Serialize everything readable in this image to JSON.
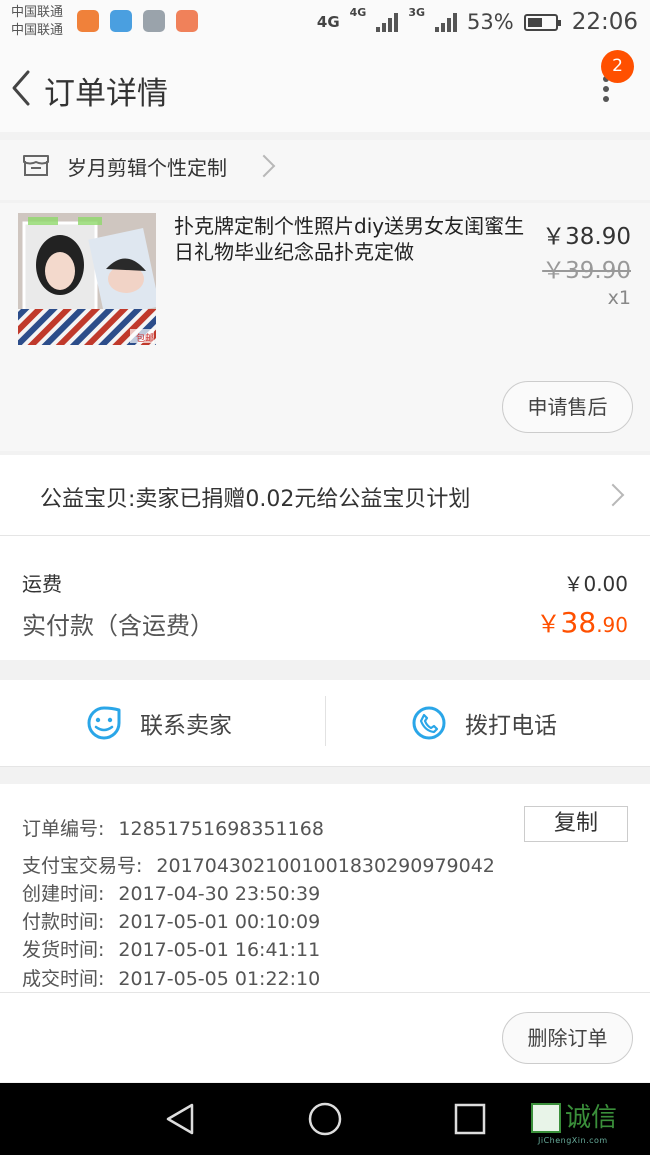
{
  "status_bar": {
    "carrier_1": "中国联通",
    "carrier_2": "中国联通",
    "network_1": "4G",
    "network_2": "4G",
    "network_3": "3G",
    "battery_percent": "53%",
    "battery_level": 0.53,
    "time": "22:06",
    "app_icons": [
      "uc-browser-icon",
      "health-icon",
      "gallery-icon",
      "camera-icon"
    ]
  },
  "header": {
    "title": "订单详情",
    "badge_count": "2"
  },
  "shop": {
    "name": "岁月剪辑个性定制"
  },
  "product": {
    "title": "扑克牌定制个性照片diy送男女友闺蜜生日礼物毕业纪念品扑克定做",
    "image_badge": "包邮",
    "price": "￥38.90",
    "original_price": "￥39.90",
    "quantity": "x1",
    "after_sale_label": "申请售后"
  },
  "charity": {
    "text": "公益宝贝:卖家已捐赠0.02元给公益宝贝计划"
  },
  "totals": {
    "shipping_label": "运费",
    "shipping_value": "￥0.00",
    "paid_label": "实付款（含运费）",
    "paid_symbol": "￥",
    "paid_integer": "38",
    "paid_decimal": ".90"
  },
  "contact": {
    "seller_label": "联系卖家",
    "phone_label": "拨打电话"
  },
  "order_info": {
    "copy_label": "复制",
    "rows": [
      {
        "label": "订单编号:",
        "value": "1285175169835116​8"
      },
      {
        "label": "支付宝交易号:",
        "value": "2017043021001001830290979042"
      },
      {
        "label": "创建时间:",
        "value": "2017-04-30 23:50:39"
      },
      {
        "label": "付款时间:",
        "value": "2017-05-01 00:10:09"
      },
      {
        "label": "发货时间:",
        "value": "2017-05-01 16:41:11"
      },
      {
        "label": "成交时间:",
        "value": "2017-05-05 01:22:10"
      }
    ]
  },
  "footer": {
    "delete_label": "删除订单"
  },
  "watermark": {
    "text": "诚信",
    "sub": "JiChengXin.com"
  },
  "colors": {
    "accent": "#ff5000",
    "icon_blue": "#2aa6e8"
  }
}
